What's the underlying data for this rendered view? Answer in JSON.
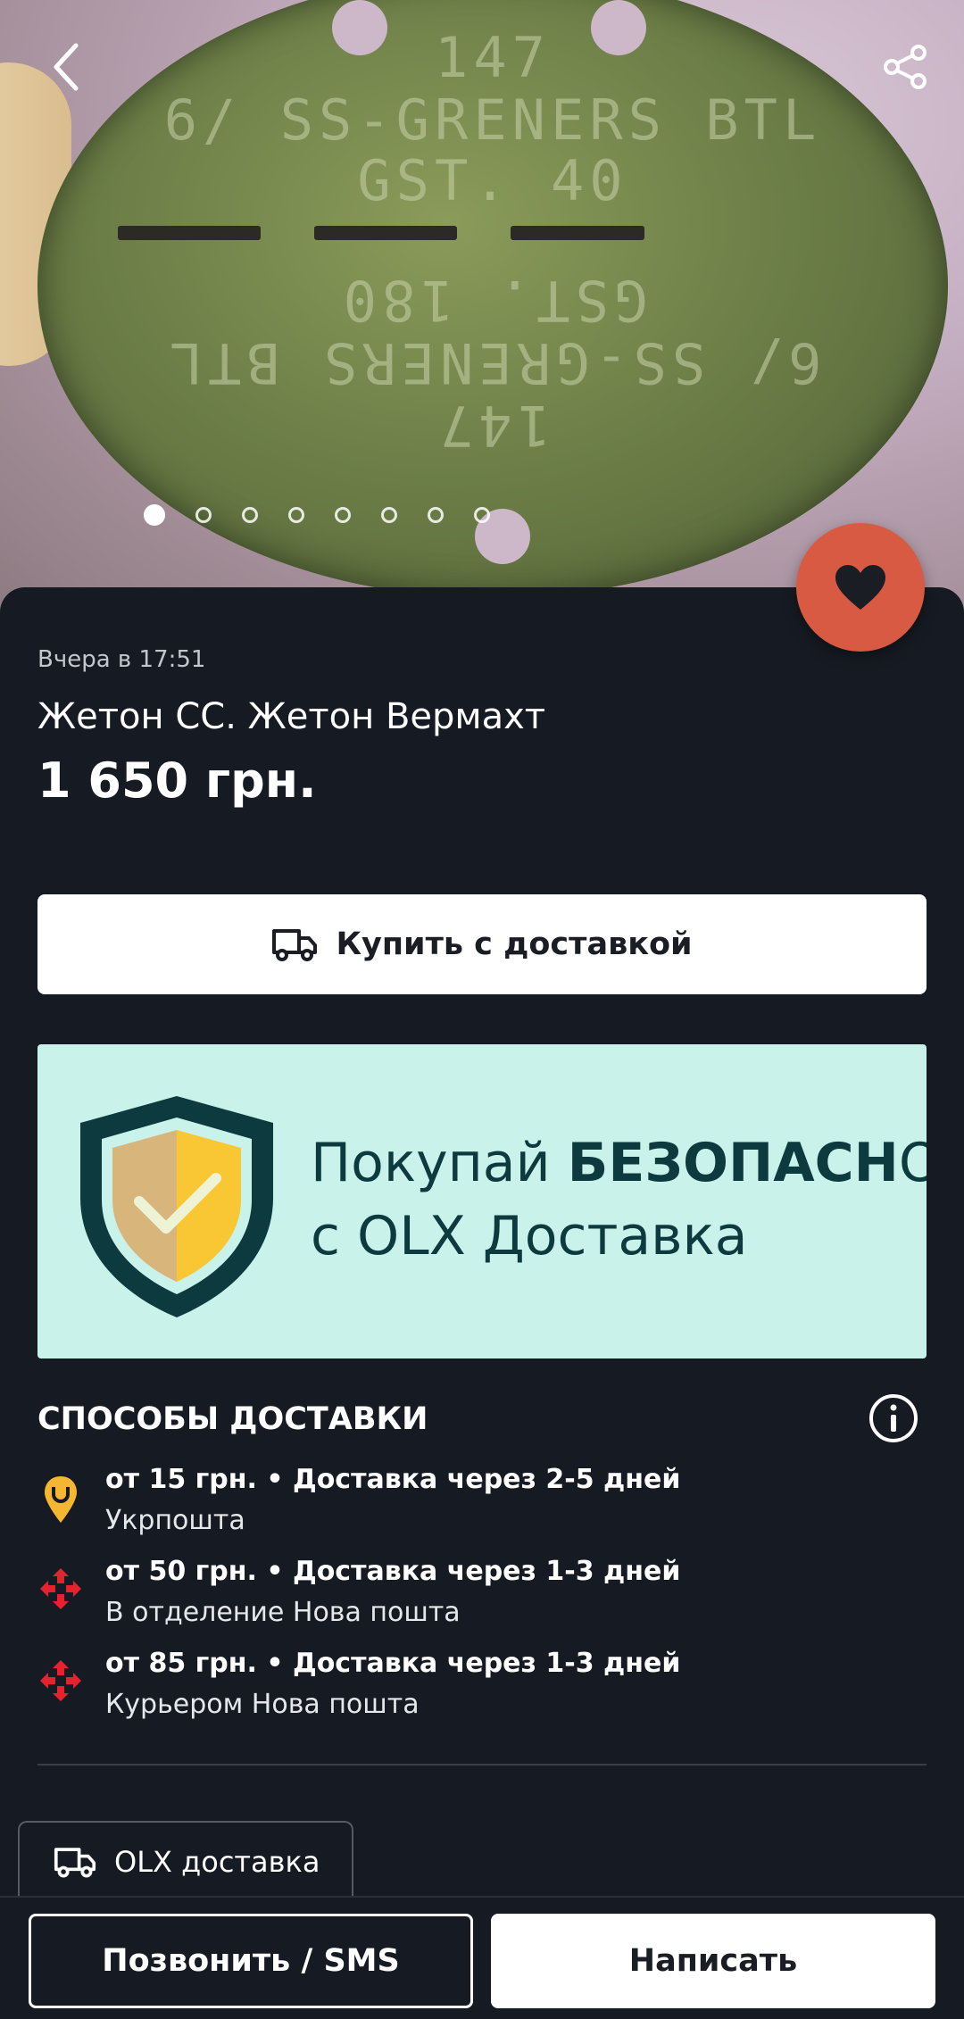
{
  "photo": {
    "engraving_lines": [
      "147",
      "6/ SS-GRENERS BTL",
      "GST. 40",
      "GST. 180",
      "6/ SS-GRENERS BTL",
      "147"
    ],
    "slide_count": 8,
    "active_slide": 1
  },
  "listing": {
    "date": "Вчера в 17:51",
    "title": "Жетон СС. Жетон Вермахт",
    "price": "1 650 грн."
  },
  "buy_button": {
    "label": "Купить с доставкой",
    "icon": "truck-icon"
  },
  "banner": {
    "line1_regular": "Покупай ",
    "line1_bold": "БЕЗОПАСН",
    "line1_end": "О",
    "line2": "с OLX Доставка"
  },
  "delivery": {
    "heading": "СПОСОБЫ ДОСТАВКИ",
    "methods": [
      {
        "price_time": "от 15 грн. • Доставка через 2-5 дней",
        "carrier": "Укрпошта",
        "icon": "ukrposhta-icon",
        "color": "#f5b731"
      },
      {
        "price_time": "от 50 грн. • Доставка через 1-3 дней",
        "carrier": "В отделение Нова пошта",
        "icon": "nova-poshta-icon",
        "color": "#e5232e"
      },
      {
        "price_time": "от 85 грн. • Доставка через 1-3 дней",
        "carrier": "Курьером Нова пошта",
        "icon": "nova-poshta-icon",
        "color": "#e5232e"
      }
    ]
  },
  "olx_chip": {
    "label": "OLX доставка"
  },
  "bottom": {
    "call_label": "Позвонить / SMS",
    "write_label": "Написать"
  },
  "colors": {
    "background": "#161a22",
    "favorite": "#d95a42",
    "banner_bg": "#c9f3ea",
    "banner_text": "#0d3a3e"
  }
}
